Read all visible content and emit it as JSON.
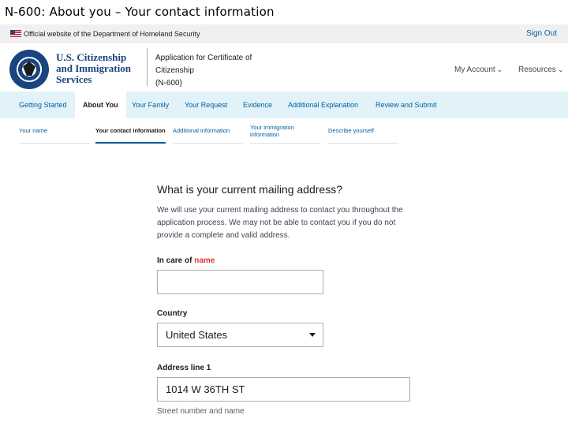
{
  "slide_title": "N-600: About you – Your contact information",
  "gov_banner": {
    "official_text": "Official website of the Department of Homeland Security",
    "sign_out": "Sign Out"
  },
  "header": {
    "agency_line1": "U.S. Citizenship",
    "agency_line2": "and Immigration",
    "agency_line3": "Services",
    "app_title_line1": "Application for Certificate of",
    "app_title_line2": "Citizenship",
    "app_title_line3": "(N-600)",
    "my_account": "My Account",
    "resources": "Resources"
  },
  "nav": {
    "items": [
      {
        "label": "Getting Started"
      },
      {
        "label": "About You"
      },
      {
        "label": "Your Family"
      },
      {
        "label": "Your Request"
      },
      {
        "label": "Evidence"
      },
      {
        "label": "Additional Explanation"
      },
      {
        "label": "Review and Submit"
      }
    ],
    "active_index": 1
  },
  "subnav": {
    "items": [
      {
        "label": "Your name"
      },
      {
        "label": "Your contact information"
      },
      {
        "label": "Additional information"
      },
      {
        "label": "Your immigration information"
      },
      {
        "label": "Describe yourself"
      }
    ],
    "active_index": 1
  },
  "form": {
    "heading": "What is your current mailing address?",
    "description": "We will use your current mailing address to contact you throughout the application process. We may not be able to contact you if you do not provide a complete and valid address.",
    "in_care_of_label": "In care of",
    "in_care_of_required": "name",
    "in_care_of_value": "",
    "country_label": "Country",
    "country_value": "United States",
    "address1_label": "Address line 1",
    "address1_value": "1014 W 36TH ST",
    "address1_hint": "Street number and name"
  },
  "colors": {
    "link_blue": "#005ea2",
    "nav_background": "#e1f3f8",
    "required_red": "#d83933",
    "banner_gray": "#f0f0f0"
  }
}
